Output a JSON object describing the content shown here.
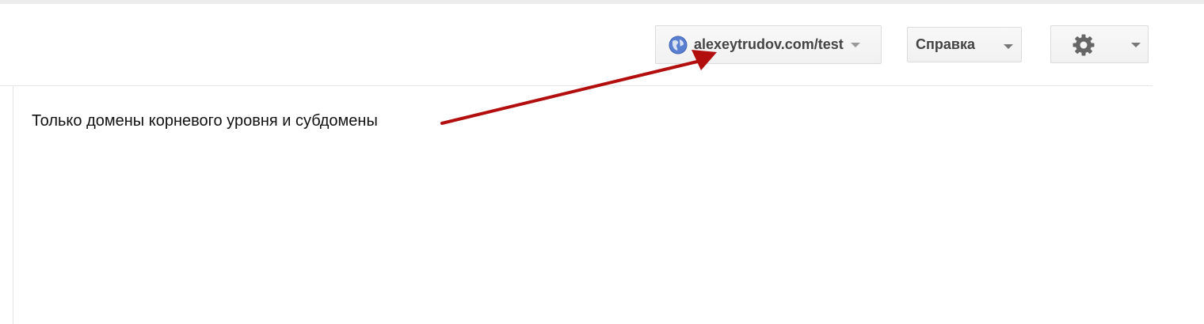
{
  "toolbar": {
    "site_selector": {
      "label": "alexeytrudov.com/test",
      "icon": "globe-icon"
    },
    "help": {
      "label": "Справка"
    },
    "settings": {
      "icon": "gear-icon"
    }
  },
  "main": {
    "annotation_text": "Только домены корневого уровня и субдомены"
  },
  "annotation": {
    "arrow_color": "#b20e0e"
  },
  "colors": {
    "button_bg": "#f5f5f5",
    "button_border": "#dcdcdc",
    "text": "#444444"
  }
}
